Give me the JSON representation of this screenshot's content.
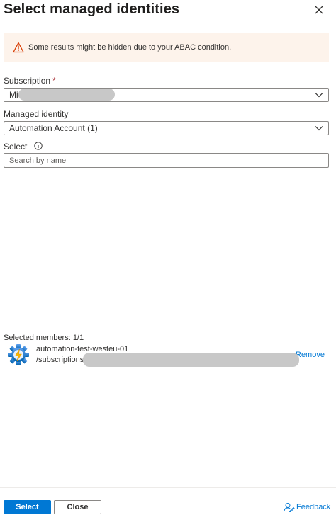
{
  "panel": {
    "title": "Select managed identities",
    "close_icon": "close-icon"
  },
  "warning": {
    "icon": "warning-triangle-icon",
    "text": "Some results might be hidden due to your ABAC condition."
  },
  "subscription": {
    "label": "Subscription",
    "required_marker": "*",
    "value_visible": "Mic",
    "value_redacted": true
  },
  "managed_identity": {
    "label": "Managed identity",
    "value": "Automation Account (1)"
  },
  "select": {
    "label": "Select",
    "info_icon": "info-icon",
    "placeholder": "Search by name"
  },
  "selected_members": {
    "heading": "Selected members: 1/1",
    "items": [
      {
        "icon": "automation-account-icon",
        "name": "automation-test-westeu-01",
        "path_visible": "/subscriptions",
        "path_redacted": true,
        "action": "Remove"
      }
    ]
  },
  "footer": {
    "select_button": "Select",
    "close_button": "Close",
    "feedback_link": "Feedback",
    "feedback_icon": "feedback-person-icon"
  },
  "colors": {
    "primary": "#0078d4",
    "warning_bg": "#fdf3eb",
    "warning_icon": "#d83b01",
    "required": "#a4262c",
    "redaction": "#c8c8c8"
  }
}
